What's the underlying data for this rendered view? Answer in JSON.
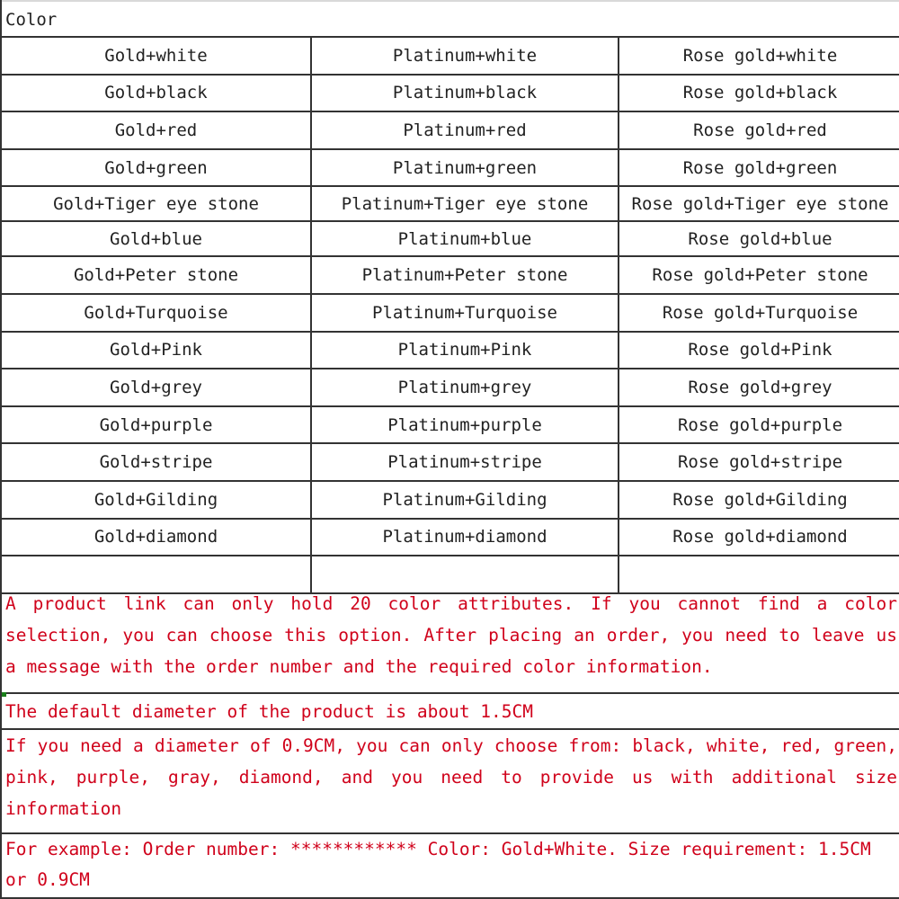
{
  "header": {
    "title": "Color"
  },
  "color_table": {
    "rows": [
      [
        "Gold+white",
        "Platinum+white",
        "Rose gold+white"
      ],
      [
        "Gold+black",
        "Platinum+black",
        "Rose gold+black"
      ],
      [
        "Gold+red",
        "Platinum+red",
        "Rose gold+red"
      ],
      [
        "Gold+green",
        "Platinum+green",
        "Rose gold+green"
      ],
      [
        "Gold+Tiger eye stone",
        "Platinum+Tiger eye stone",
        "Rose gold+Tiger eye stone"
      ],
      [
        "Gold+blue",
        "Platinum+blue",
        "Rose gold+blue"
      ],
      [
        "Gold+Peter stone",
        "Platinum+Peter stone",
        "Rose gold+Peter stone"
      ],
      [
        "Gold+Turquoise",
        "Platinum+Turquoise",
        "Rose gold+Turquoise"
      ],
      [
        "Gold+Pink",
        "Platinum+Pink",
        "Rose gold+Pink"
      ],
      [
        "Gold+grey",
        "Platinum+grey",
        "Rose gold+grey"
      ],
      [
        "Gold+purple",
        "Platinum+purple",
        "Rose gold+purple"
      ],
      [
        "Gold+stripe",
        "Platinum+stripe",
        "Rose gold+stripe"
      ],
      [
        "Gold+Gilding",
        "Platinum+Gilding",
        "Rose gold+Gilding"
      ],
      [
        "Gold+diamond",
        "Platinum+diamond",
        "Rose gold+diamond"
      ],
      [
        "",
        "",
        ""
      ]
    ]
  },
  "notes": {
    "color_limit": "A product link can only hold 20 color attributes. If you cannot find a color selection, you can choose this option. After placing an order, you need to leave us a message with the order number and the required color information.",
    "default_diameter": "The default diameter of the product is about 1.5CM",
    "small_diameter": "If you need a diameter of 0.9CM, you can only choose from: black, white, red, green, pink, purple, gray, diamond, and you need to provide us with additional size information",
    "example": "For example: Order number: ************ Color: Gold+White. Size requirement: 1.5CM or 0.9CM"
  },
  "colors": {
    "note_text": "#d0021b",
    "grid_line": "#333333"
  }
}
